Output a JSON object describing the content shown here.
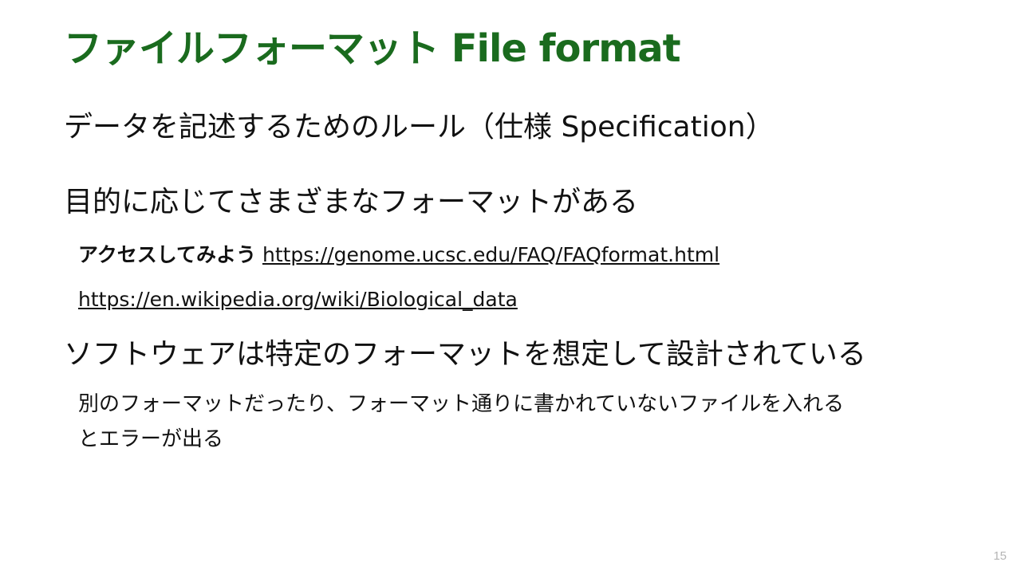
{
  "slide": {
    "title": "ファイルフォーマット File format",
    "definition": "データを記述するためのルール（仕様 Specification）",
    "purpose": "目的に応じてさまざまなフォーマットがある",
    "access_label": "アクセスしてみよう",
    "link_ucsc": "https://genome.ucsc.edu/FAQ/FAQformat.html",
    "link_wikipedia": "https://en.wikipedia.org/wiki/Biological_data",
    "software_note": "ソフトウェアは特定のフォーマットを想定して設計されている",
    "error_note_line1": "別のフォーマットだったり、フォーマット通りに書かれていないファイルを入れる",
    "error_note_line2": "とエラーが出る",
    "page_number": "15"
  },
  "colors": {
    "title": "#1a6b1e",
    "text": "#111111",
    "page_number": "#b5b5b5"
  }
}
